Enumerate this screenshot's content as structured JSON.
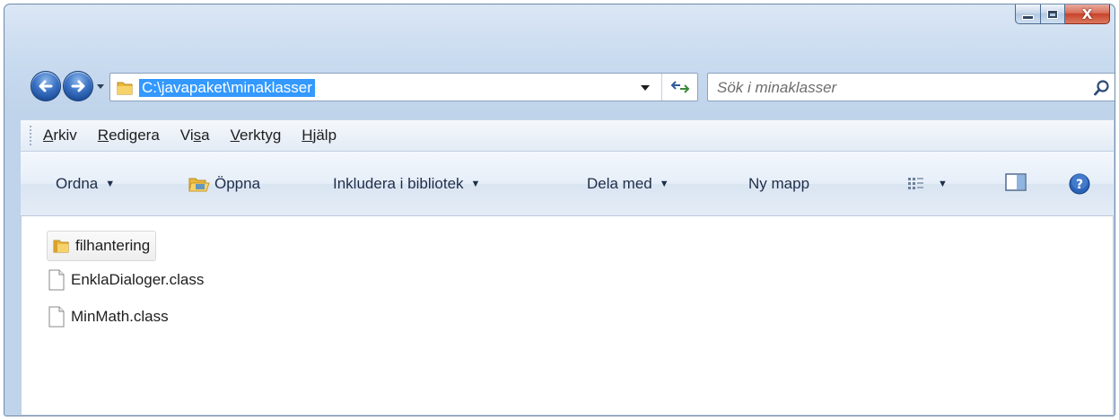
{
  "window": {
    "caption_buttons": [
      "minimize",
      "maximize",
      "close"
    ],
    "close_glyph": "X"
  },
  "navigation": {
    "back_icon": "back-arrow-icon",
    "forward_icon": "forward-arrow-icon",
    "address": "C:\\javapaket\\minaklasser",
    "address_selected": true,
    "search_placeholder": "Sök i minaklasser"
  },
  "menu": {
    "items": [
      {
        "label": "Arkiv",
        "accel": "A"
      },
      {
        "label": "Redigera",
        "accel": "R"
      },
      {
        "label": "Visa",
        "accel": "s"
      },
      {
        "label": "Verktyg",
        "accel": "V"
      },
      {
        "label": "Hjälp",
        "accel": "H"
      }
    ]
  },
  "commands": {
    "ordna": "Ordna",
    "oppna": "Öppna",
    "inkludera": "Inkludera i bibliotek",
    "dela": "Dela med",
    "ny_mapp": "Ny mapp"
  },
  "files": [
    {
      "name": "filhantering",
      "type": "folder"
    },
    {
      "name": "EnklaDialoger.class",
      "type": "file"
    },
    {
      "name": "MinMath.class",
      "type": "file"
    }
  ],
  "colors": {
    "selection": "#3399ff",
    "chrome": "#c9dbef",
    "close": "#c8432b"
  }
}
